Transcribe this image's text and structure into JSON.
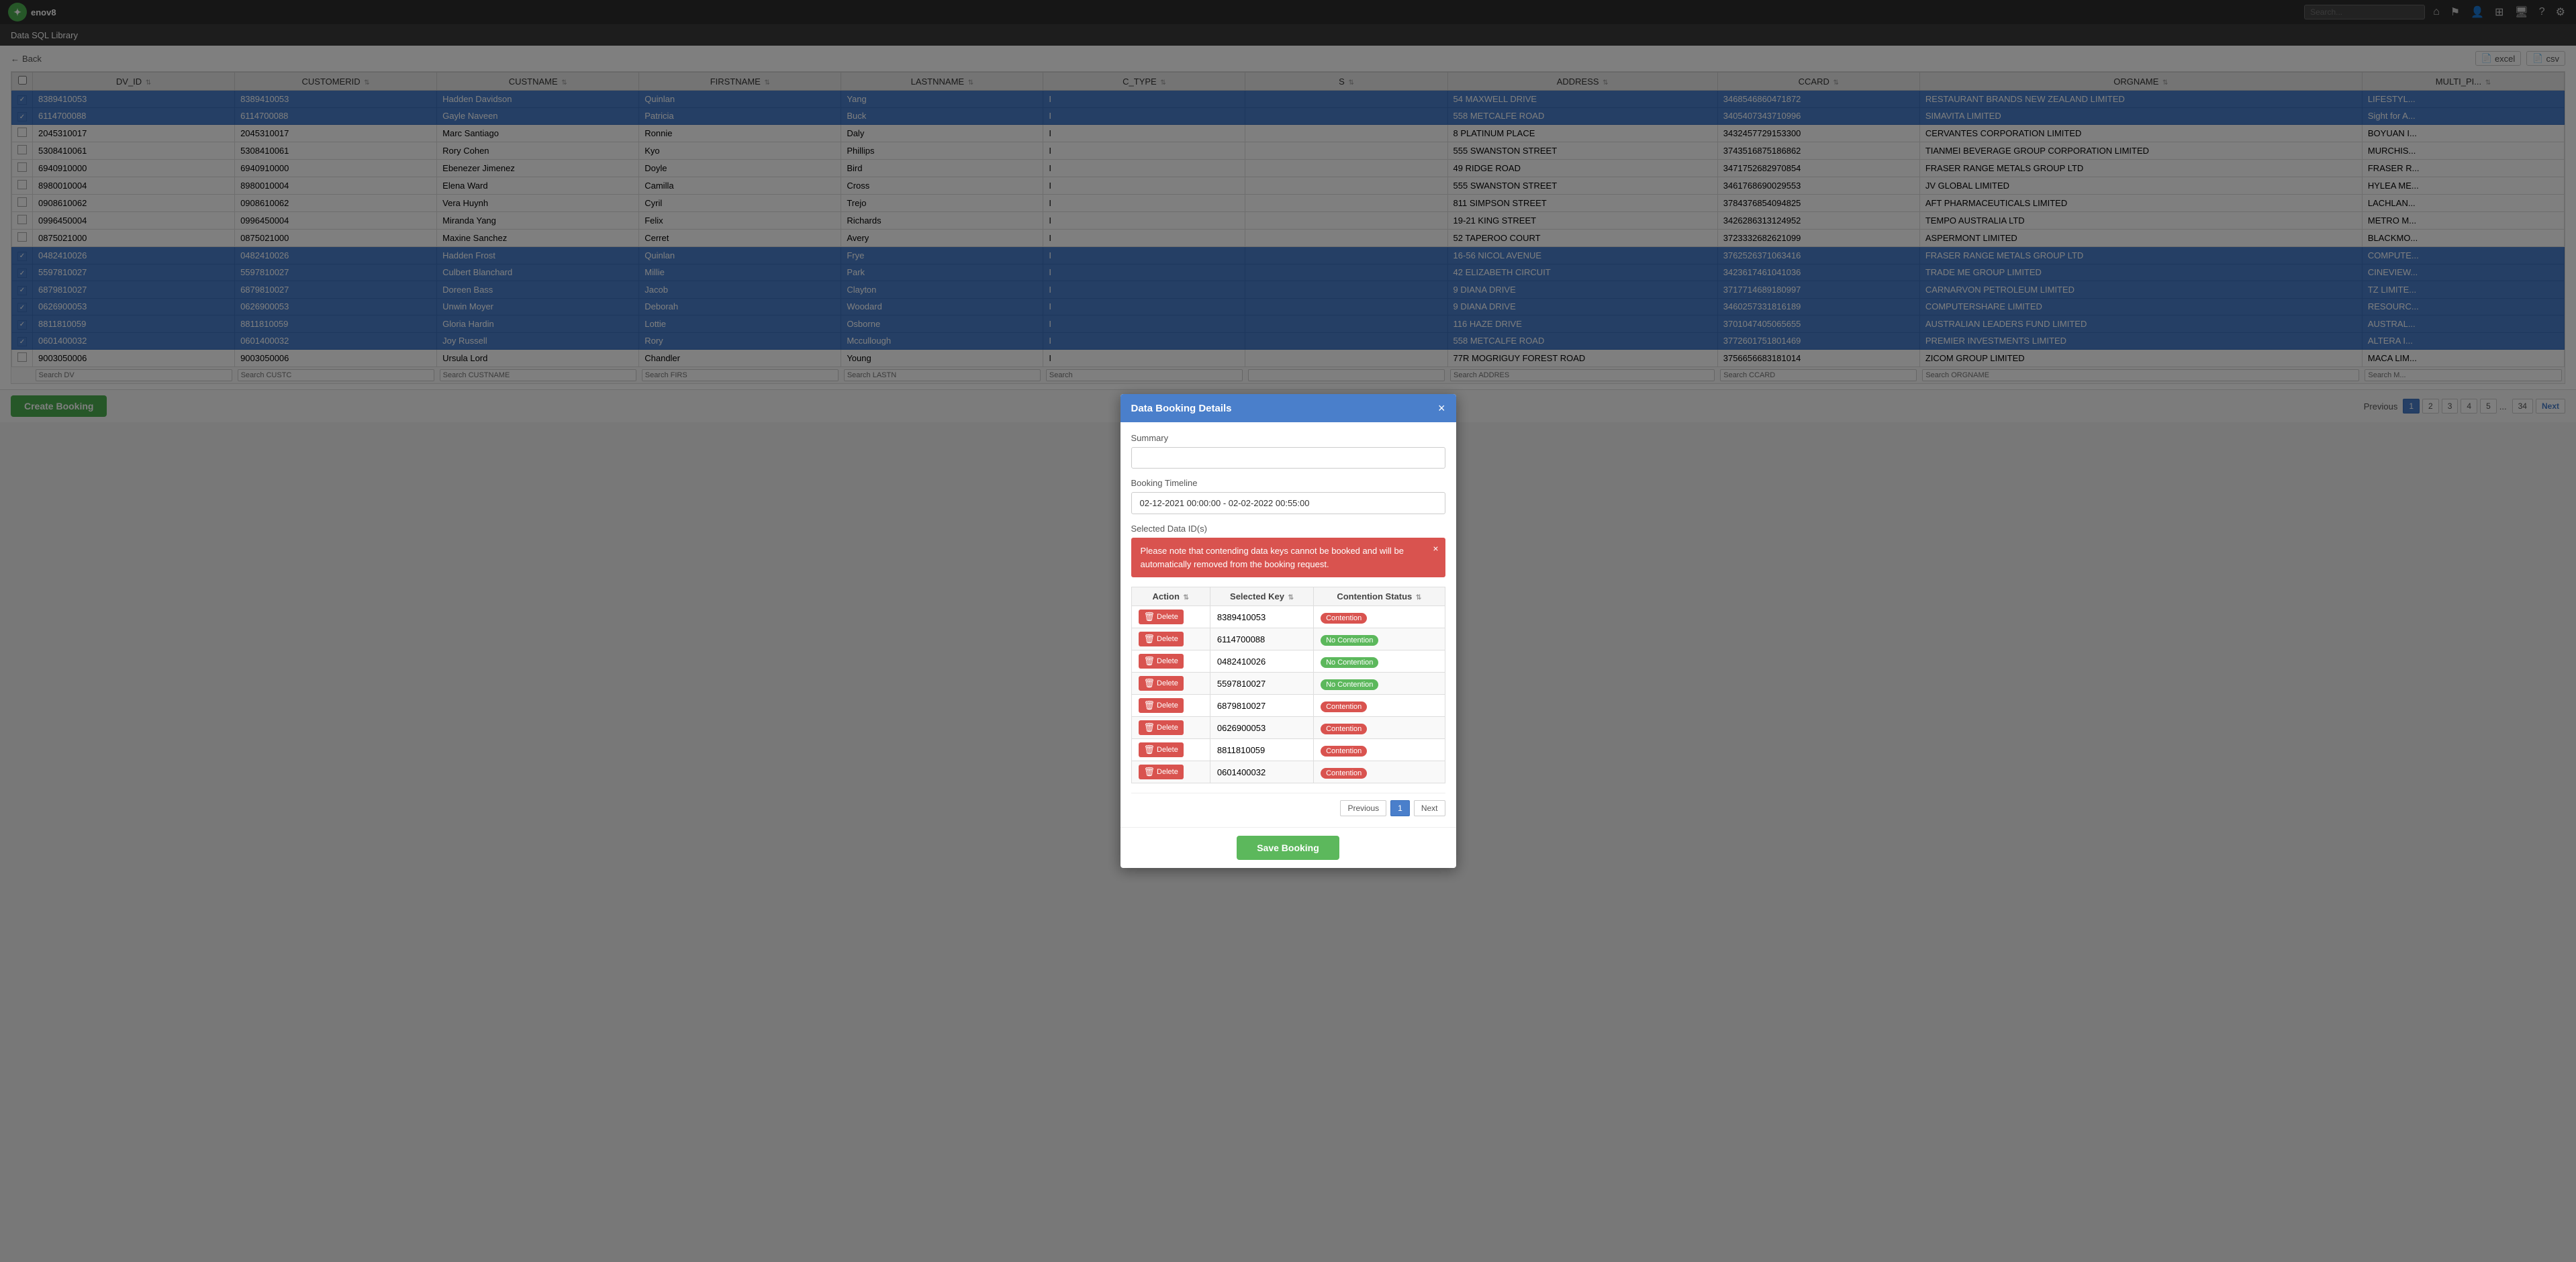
{
  "app": {
    "brand": "enov8",
    "logo_symbol": "✦"
  },
  "navbar": {
    "search_placeholder": "Search..."
  },
  "page_header": {
    "title": "Data SQL Library"
  },
  "toolbar": {
    "back_label": "Back",
    "excel_label": "excel",
    "csv_label": "csv"
  },
  "table": {
    "columns": [
      {
        "key": "checkbox",
        "label": ""
      },
      {
        "key": "dv_id",
        "label": "DV_ID"
      },
      {
        "key": "customerid",
        "label": "CUSTOMERID"
      },
      {
        "key": "custname",
        "label": "CUSTNAME"
      },
      {
        "key": "firstname",
        "label": "FIRSTNAME"
      },
      {
        "key": "lastname",
        "label": "LASTNNAME"
      },
      {
        "key": "c_type",
        "label": "C_TYPE"
      },
      {
        "key": "s",
        "label": "S"
      },
      {
        "key": "address",
        "label": "ADDRESS"
      },
      {
        "key": "ccard",
        "label": "CCARD"
      },
      {
        "key": "orgname",
        "label": "ORGNAME"
      },
      {
        "key": "multi_pi",
        "label": "MULTI_PI..."
      }
    ],
    "rows": [
      {
        "checkbox": true,
        "selected": true,
        "dv_id": "8389410053",
        "customerid": "8389410053",
        "custname": "Hadden Davidson",
        "firstname": "Quinlan",
        "lastname": "Yang",
        "c_type": "I",
        "s": "",
        "address": "54 MAXWELL DRIVE",
        "ccard": "3468546860471872",
        "orgname": "RESTAURANT BRANDS NEW ZEALAND LIMITED",
        "multi_pi": "LIFESTYL..."
      },
      {
        "checkbox": true,
        "selected": true,
        "dv_id": "6114700088",
        "customerid": "6114700088",
        "custname": "Gayle Naveen",
        "firstname": "Patricia",
        "lastname": "Buck",
        "c_type": "I",
        "s": "",
        "address": "558 METCALFE ROAD",
        "ccard": "3405407343710996",
        "orgname": "SIMAVITA LIMITED",
        "multi_pi": "Sight for A..."
      },
      {
        "checkbox": false,
        "selected": false,
        "dv_id": "2045310017",
        "customerid": "2045310017",
        "custname": "Marc Santiago",
        "firstname": "Ronnie",
        "lastname": "Daly",
        "c_type": "I",
        "s": "",
        "address": "8 PLATINUM PLACE",
        "ccard": "3432457729153300",
        "orgname": "CERVANTES CORPORATION LIMITED",
        "multi_pi": "BOYUAN I..."
      },
      {
        "checkbox": false,
        "selected": false,
        "dv_id": "5308410061",
        "customerid": "5308410061",
        "custname": "Rory Cohen",
        "firstname": "Kyo",
        "lastname": "Phillips",
        "c_type": "I",
        "s": "",
        "address": "555 SWANSTON STREET",
        "ccard": "3743516875186862",
        "orgname": "TIANMEI BEVERAGE GROUP CORPORATION LIMITED",
        "multi_pi": "MURCHIS..."
      },
      {
        "checkbox": false,
        "selected": false,
        "dv_id": "6940910000",
        "customerid": "6940910000",
        "custname": "Ebenezer Jimenez",
        "firstname": "Doyle",
        "lastname": "Bird",
        "c_type": "I",
        "s": "",
        "address": "49 RIDGE ROAD",
        "ccard": "3471752682970854",
        "orgname": "FRASER RANGE METALS GROUP LTD",
        "multi_pi": "FRASER R..."
      },
      {
        "checkbox": false,
        "selected": false,
        "dv_id": "8980010004",
        "customerid": "8980010004",
        "custname": "Elena Ward",
        "firstname": "Camilla",
        "lastname": "Cross",
        "c_type": "I",
        "s": "",
        "address": "555 SWANSTON STREET",
        "ccard": "3461768690029553",
        "orgname": "JV GLOBAL LIMITED",
        "multi_pi": "HYLEA ME..."
      },
      {
        "checkbox": false,
        "selected": false,
        "dv_id": "0908610062",
        "customerid": "0908610062",
        "custname": "Vera Huynh",
        "firstname": "Cyril",
        "lastname": "Trejo",
        "c_type": "I",
        "s": "",
        "address": "811 SIMPSON STREET",
        "ccard": "3784376854094825",
        "orgname": "AFT PHARMACEUTICALS LIMITED",
        "multi_pi": "LACHLAN..."
      },
      {
        "checkbox": false,
        "selected": false,
        "dv_id": "0996450004",
        "customerid": "0996450004",
        "custname": "Miranda Yang",
        "firstname": "Felix",
        "lastname": "Richards",
        "c_type": "I",
        "s": "",
        "address": "19-21 KING STREET",
        "ccard": "3426286313124952",
        "orgname": "TEMPO AUSTRALIA LTD",
        "multi_pi": "METRO M..."
      },
      {
        "checkbox": false,
        "selected": false,
        "dv_id": "0875021000",
        "customerid": "0875021000",
        "custname": "Maxine Sanchez",
        "firstname": "Cerret",
        "lastname": "Avery",
        "c_type": "I",
        "s": "",
        "address": "52 TAPEROO COURT",
        "ccard": "3723332682621099",
        "orgname": "ASPERMONT LIMITED",
        "multi_pi": "BLACKMO..."
      },
      {
        "checkbox": true,
        "selected": true,
        "dv_id": "0482410026",
        "customerid": "0482410026",
        "custname": "Hadden Frost",
        "firstname": "Quinlan",
        "lastname": "Frye",
        "c_type": "I",
        "s": "",
        "address": "16-56 NICOL AVENUE",
        "ccard": "3762526371063416",
        "orgname": "FRASER RANGE METALS GROUP LTD",
        "multi_pi": "COMPUTE..."
      },
      {
        "checkbox": true,
        "selected": true,
        "dv_id": "5597810027",
        "customerid": "5597810027",
        "custname": "Culbert Blanchard",
        "firstname": "Millie",
        "lastname": "Park",
        "c_type": "I",
        "s": "",
        "address": "42 ELIZABETH CIRCUIT",
        "ccard": "3423617461041036",
        "orgname": "TRADE ME GROUP LIMITED",
        "multi_pi": "CINEVIEW..."
      },
      {
        "checkbox": true,
        "selected": true,
        "dv_id": "6879810027",
        "customerid": "6879810027",
        "custname": "Doreen Bass",
        "firstname": "Jacob",
        "lastname": "Clayton",
        "c_type": "I",
        "s": "",
        "address": "9 DIANA DRIVE",
        "ccard": "3717714689180997",
        "orgname": "CARNARVON PETROLEUM LIMITED",
        "multi_pi": "TZ LIMITE..."
      },
      {
        "checkbox": true,
        "selected": true,
        "dv_id": "0626900053",
        "customerid": "0626900053",
        "custname": "Unwin Moyer",
        "firstname": "Deborah",
        "lastname": "Woodard",
        "c_type": "I",
        "s": "",
        "address": "9 DIANA DRIVE",
        "ccard": "3460257331816189",
        "orgname": "COMPUTERSHARE LIMITED",
        "multi_pi": "RESOURC..."
      },
      {
        "checkbox": true,
        "selected": true,
        "dv_id": "8811810059",
        "customerid": "8811810059",
        "custname": "Gloria Hardin",
        "firstname": "Lottie",
        "lastname": "Osborne",
        "c_type": "I",
        "s": "",
        "address": "116 HAZE DRIVE",
        "ccard": "3701047405065655",
        "orgname": "AUSTRALIAN LEADERS FUND LIMITED",
        "multi_pi": "AUSTRAL..."
      },
      {
        "checkbox": true,
        "selected": true,
        "dv_id": "0601400032",
        "customerid": "0601400032",
        "custname": "Joy Russell",
        "firstname": "Rory",
        "lastname": "Mccullough",
        "c_type": "I",
        "s": "",
        "address": "558 METCALFE ROAD",
        "ccard": "3772601751801469",
        "orgname": "PREMIER INVESTMENTS LIMITED",
        "multi_pi": "ALTERA I..."
      },
      {
        "checkbox": false,
        "selected": false,
        "dv_id": "9003050006",
        "customerid": "9003050006",
        "custname": "Ursula Lord",
        "firstname": "Chandler",
        "lastname": "Young",
        "c_type": "I",
        "s": "",
        "address": "77R MOGRIGUY FOREST ROAD",
        "ccard": "3756656683181014",
        "orgname": "ZICOM GROUP LIMITED",
        "multi_pi": "MACA LIM..."
      }
    ],
    "search_row": {
      "dv_id": "Search DV",
      "customerid": "Search CUSTC",
      "custname": "Search CUSTNAME",
      "firstname": "Search FIRS",
      "lastname": "Search LASTN",
      "s": "Search",
      "address": "Search ADDRES",
      "ccard": "Search CCARD",
      "orgname": "Search ORGNAME",
      "multi_pi": "Search M..."
    }
  },
  "bottom_bar": {
    "create_booking_label": "Create Booking",
    "pagination": {
      "previous_label": "Previous",
      "next_label": "Next",
      "pages": [
        "1",
        "2",
        "3",
        "4",
        "5"
      ],
      "last_page": "34",
      "current_page": "1"
    }
  },
  "modal": {
    "title": "Data Booking Details",
    "close_icon": "×",
    "summary_label": "Summary",
    "summary_value": "",
    "timeline_label": "Booking Timeline",
    "timeline_value": "02-12-2021 00:00:00 - 02-02-2022 00:55:00",
    "selected_ids_label": "Selected Data ID(s)",
    "alert_text": "Please note that contending data keys cannot be booked and will be automatically removed from the booking request.",
    "table": {
      "col_action": "Action",
      "col_key": "Selected Key",
      "col_status": "Contention Status",
      "rows": [
        {
          "key": "8389410053",
          "status": "Contention",
          "contention": true
        },
        {
          "key": "6114700088",
          "status": "No Contention",
          "contention": false
        },
        {
          "key": "0482410026",
          "status": "No Contention",
          "contention": false
        },
        {
          "key": "5597810027",
          "status": "No Contention",
          "contention": false
        },
        {
          "key": "6879810027",
          "status": "Contention",
          "contention": true
        },
        {
          "key": "0626900053",
          "status": "Contention",
          "contention": true
        },
        {
          "key": "8811810059",
          "status": "Contention",
          "contention": true
        },
        {
          "key": "0601400032",
          "status": "Contention",
          "contention": true
        }
      ]
    },
    "pagination": {
      "previous_label": "Previous",
      "next_label": "Next",
      "current_page": "1"
    },
    "save_booking_label": "Save Booking",
    "delete_label": "Delete"
  }
}
